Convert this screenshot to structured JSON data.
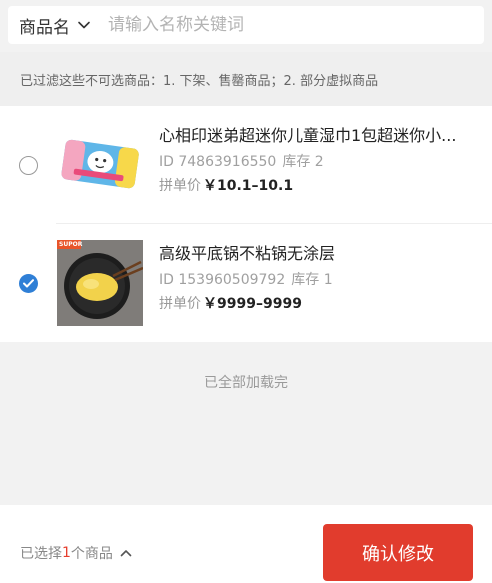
{
  "search": {
    "type_label": "商品名",
    "placeholder": "请输入名称关键词"
  },
  "notice": "已过滤这些不可选商品：1. 下架、售罄商品；2. 部分虚拟商品",
  "products": [
    {
      "title": "心相印迷弟超迷你儿童湿巾1包超迷你小...",
      "id_label": "ID 74863916550",
      "stock_label": "库存 2",
      "price_label": "拼单价",
      "price": "￥10.1–10.1",
      "selected": false
    },
    {
      "title": "高级平底锅不粘锅无涂层",
      "id_label": "ID 153960509792",
      "stock_label": "库存 1",
      "price_label": "拼单价",
      "price": "￥9999–9999",
      "selected": true,
      "image_badge": "SUPOR"
    }
  ],
  "end_text": "已全部加载完",
  "footer": {
    "selected_prefix": "已选择",
    "selected_count": "1",
    "selected_suffix": "个商品",
    "confirm_label": "确认修改"
  },
  "colors": {
    "accent_red": "#e13c2d",
    "check_blue": "#2f7fd6"
  }
}
